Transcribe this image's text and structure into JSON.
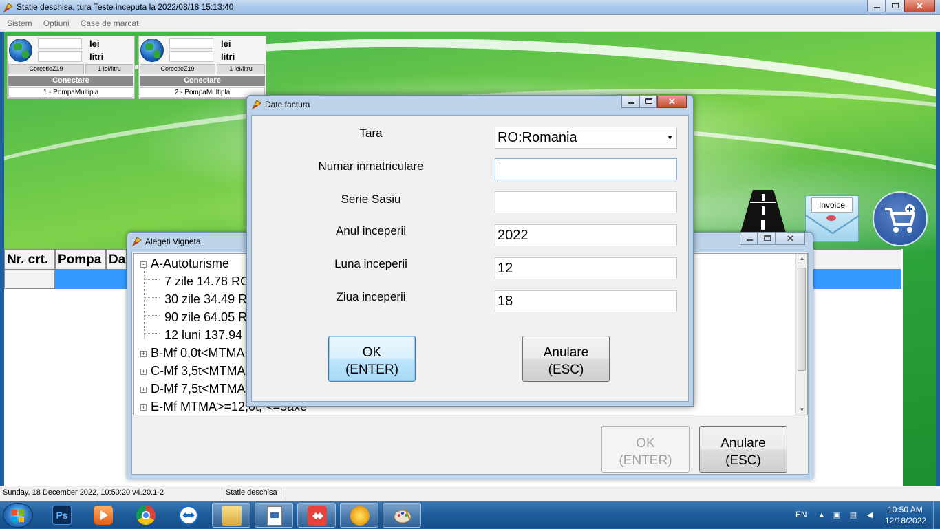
{
  "window": {
    "title": "Statie deschisa, tura Teste inceputa la 2022/08/18 15:13:40"
  },
  "menu": [
    "Sistem",
    "Optiuni",
    "Case de marcat"
  ],
  "pumps": [
    {
      "unit_money": "lei",
      "unit_volume": "litri",
      "correction": "CorectieZ19",
      "price": "1 lei/litru",
      "connect": "Conectare",
      "name": "1 - PompaMultipla"
    },
    {
      "unit_money": "lei",
      "unit_volume": "litri",
      "correction": "CorectieZ19",
      "price": "1 lei/litru",
      "connect": "Conectare",
      "name": "2 - PompaMultipla"
    }
  ],
  "invoice_icon_label": "Invoice",
  "grid": {
    "headers": [
      "Nr. crt.",
      "Pompa",
      "Da"
    ]
  },
  "vigneta_dialog": {
    "title": "Alegeti Vigneta",
    "tree": [
      {
        "label": "A-Autoturisme",
        "expander": "-"
      },
      {
        "label": "7 zile 14.78 RO"
      },
      {
        "label": "30 zile 34.49 R"
      },
      {
        "label": "90 zile 64.05 R"
      },
      {
        "label": "12 luni 137.94"
      },
      {
        "label": "B-Mf 0,0t<MTMA",
        "expander": "+"
      },
      {
        "label": "C-Mf 3,5t<MTMA",
        "expander": "+"
      },
      {
        "label": "D-Mf 7,5t<MTMA",
        "expander": "+"
      },
      {
        "label": "E-Mf MTMA>=12,0t, <=3axe",
        "expander": "+"
      }
    ],
    "ok": {
      "line1": "OK",
      "line2": "(ENTER)",
      "enabled": false
    },
    "cancel": {
      "line1": "Anulare",
      "line2": "(ESC)"
    }
  },
  "factura_dialog": {
    "title": "Date factura",
    "fields": [
      {
        "label": "Tara",
        "value": "RO:Romania",
        "type": "select"
      },
      {
        "label": "Numar inmatriculare",
        "value": "",
        "type": "text",
        "focused": true
      },
      {
        "label": "Serie Sasiu",
        "value": "",
        "type": "text"
      },
      {
        "label": "Anul inceperii",
        "value": "2022",
        "type": "text"
      },
      {
        "label": "Luna inceperii",
        "value": "12",
        "type": "text"
      },
      {
        "label": "Ziua inceperii",
        "value": "18",
        "type": "text"
      }
    ],
    "ok": {
      "line1": "OK",
      "line2": "(ENTER)"
    },
    "cancel": {
      "line1": "Anulare",
      "line2": "(ESC)"
    }
  },
  "status": {
    "datetime": "Sunday, 18 December 2022, 10:50:20 v4.20.1-2",
    "state": "Statie deschisa"
  },
  "taskbar": {
    "language": "EN",
    "time": "10:50 AM",
    "date": "12/18/2022",
    "apps": [
      "photoshop",
      "media-player",
      "chrome",
      "teamviewer",
      "file-explorer",
      "document-app",
      "anydesk",
      "sun-app",
      "paint"
    ]
  },
  "colors": {
    "selection": "#3399ff",
    "dialog_frame": "#bcd3ea",
    "taskbar": "#1f5d9c"
  }
}
